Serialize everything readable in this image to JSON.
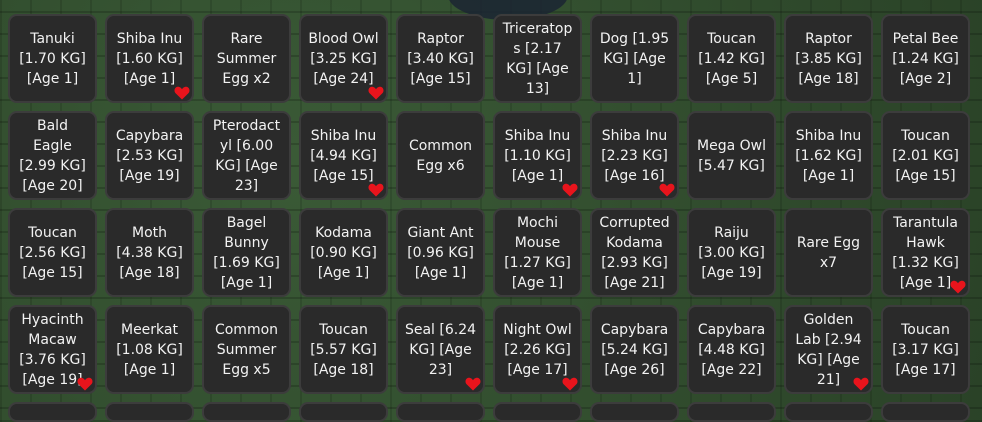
{
  "inventory": {
    "items": [
      {
        "label": "Tanuki\n[1.70 KG]\n[Age 1]",
        "favorited": false
      },
      {
        "label": "Shiba Inu\n[1.60 KG]\n[Age 1]",
        "favorited": true
      },
      {
        "label": "Rare\nSummer\nEgg x2",
        "favorited": false
      },
      {
        "label": "Blood Owl\n[3.25 KG]\n[Age 24]",
        "favorited": true
      },
      {
        "label": "Raptor\n[3.40 KG]\n[Age 15]",
        "favorited": false
      },
      {
        "label": "Triceratop\ns [2.17\nKG] [Age\n13]",
        "favorited": false
      },
      {
        "label": "Dog [1.95\nKG] [Age\n1]",
        "favorited": false
      },
      {
        "label": "Toucan\n[1.42 KG]\n[Age 5]",
        "favorited": false
      },
      {
        "label": "Raptor\n[3.85 KG]\n[Age 18]",
        "favorited": false
      },
      {
        "label": "Petal Bee\n[1.24 KG]\n[Age 2]",
        "favorited": false
      },
      {
        "label": "Bald\nEagle\n[2.99 KG]\n[Age 20]",
        "favorited": false
      },
      {
        "label": "Capybara\n[2.53 KG]\n[Age 19]",
        "favorited": false
      },
      {
        "label": "Pterodact\nyl [6.00\nKG] [Age\n23]",
        "favorited": false
      },
      {
        "label": "Shiba Inu\n[4.94 KG]\n[Age 15]",
        "favorited": true
      },
      {
        "label": "Common\nEgg x6",
        "favorited": false
      },
      {
        "label": "Shiba Inu\n[1.10 KG]\n[Age 1]",
        "favorited": true
      },
      {
        "label": "Shiba Inu\n[2.23 KG]\n[Age 16]",
        "favorited": true
      },
      {
        "label": "Mega Owl\n[5.47 KG]",
        "favorited": false
      },
      {
        "label": "Shiba Inu\n[1.62 KG]\n[Age 1]",
        "favorited": false
      },
      {
        "label": "Toucan\n[2.01 KG]\n[Age 15]",
        "favorited": false
      },
      {
        "label": "Toucan\n[2.56 KG]\n[Age 15]",
        "favorited": false
      },
      {
        "label": "Moth\n[4.38 KG]\n[Age 18]",
        "favorited": false
      },
      {
        "label": "Bagel\nBunny\n[1.69 KG]\n[Age 1]",
        "favorited": false
      },
      {
        "label": "Kodama\n[0.90 KG]\n[Age 1]",
        "favorited": false
      },
      {
        "label": "Giant Ant\n[0.96 KG]\n[Age 1]",
        "favorited": false
      },
      {
        "label": "Mochi\nMouse\n[1.27 KG]\n[Age 1]",
        "favorited": false
      },
      {
        "label": "Corrupted\nKodama\n[2.93 KG]\n[Age 21]",
        "favorited": false
      },
      {
        "label": "Raiju\n[3.00 KG]\n[Age 19]",
        "favorited": false
      },
      {
        "label": "Rare Egg\nx7",
        "favorited": false
      },
      {
        "label": "Tarantula\nHawk\n[1.32 KG]\n[Age 1]",
        "favorited": true
      },
      {
        "label": "Hyacinth\nMacaw\n[3.76 KG]\n[Age 19]",
        "favorited": true
      },
      {
        "label": "Meerkat\n[1.08 KG]\n[Age 1]",
        "favorited": false
      },
      {
        "label": "Common\nSummer\nEgg x5",
        "favorited": false
      },
      {
        "label": "Toucan\n[5.57 KG]\n[Age 18]",
        "favorited": false
      },
      {
        "label": "Seal [6.24\nKG] [Age\n23]",
        "favorited": true
      },
      {
        "label": "Night Owl\n[2.26 KG]\n[Age 17]",
        "favorited": true
      },
      {
        "label": "Capybara\n[5.24 KG]\n[Age 26]",
        "favorited": false
      },
      {
        "label": "Capybara\n[4.48 KG]\n[Age 22]",
        "favorited": false
      },
      {
        "label": "Golden\nLab [2.94\nKG] [Age\n21]",
        "favorited": true
      },
      {
        "label": "Toucan\n[3.17 KG]\n[Age 17]",
        "favorited": false
      }
    ]
  },
  "colors": {
    "slot_bg": "#2a2a2a",
    "text": "#f2f2f2",
    "heart": "#e8141c",
    "background": "#2f4a2c"
  },
  "icons": {
    "favorite": "heart-icon"
  }
}
